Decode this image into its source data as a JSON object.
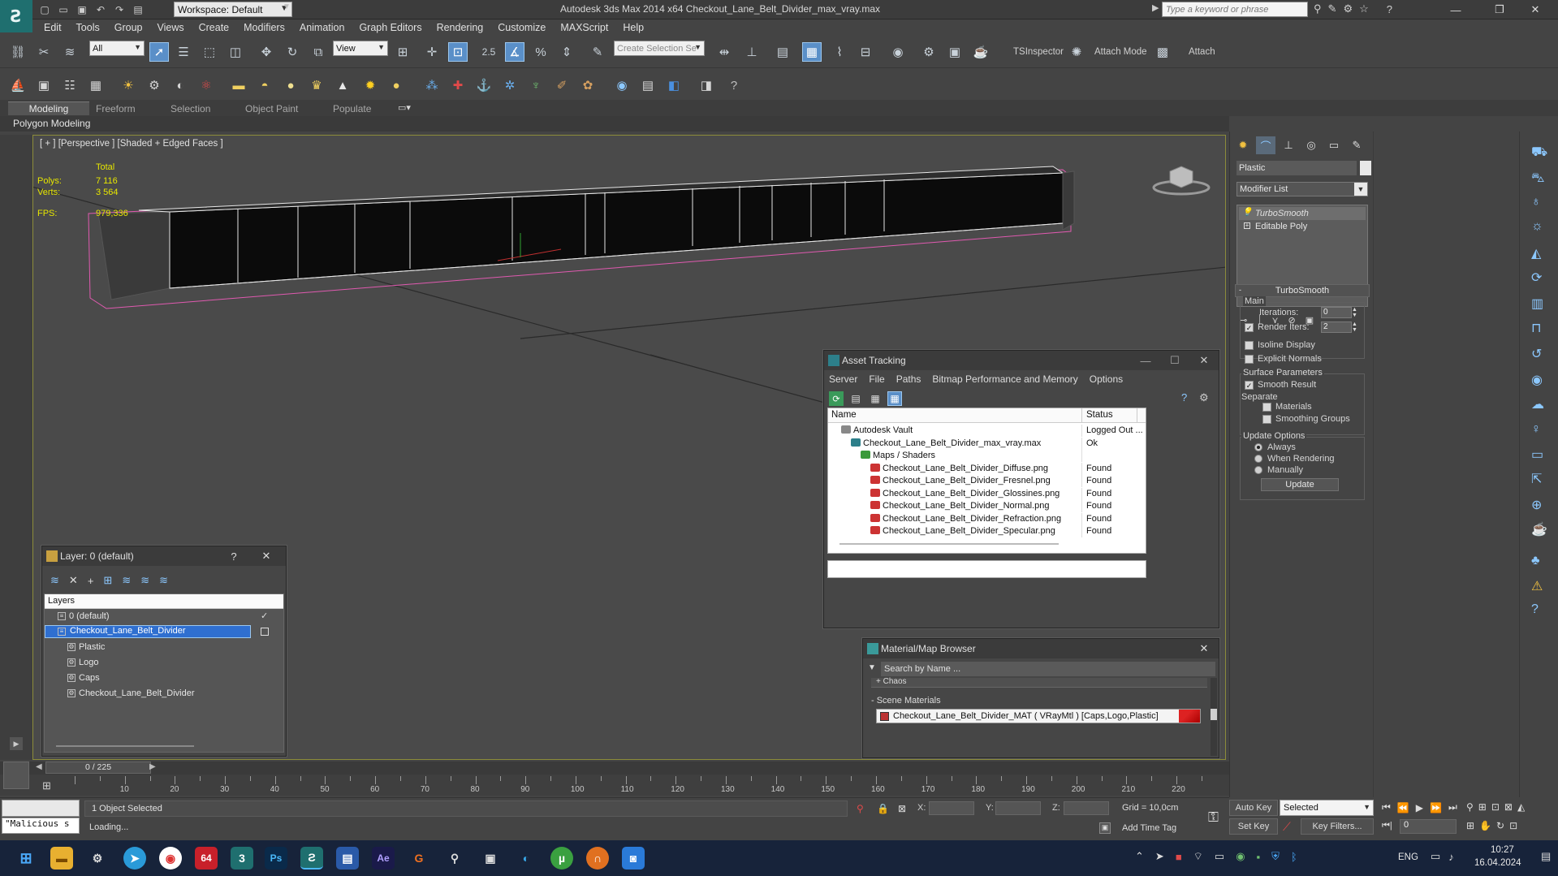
{
  "titlebar": {
    "workspace": "Workspace: Default",
    "app_title": "Autodesk 3ds Max  2014 x64     Checkout_Lane_Belt_Divider_max_vray.max",
    "search_placeholder": "Type a keyword or phrase"
  },
  "menu": [
    "Edit",
    "Tools",
    "Group",
    "Views",
    "Create",
    "Modifiers",
    "Animation",
    "Graph Editors",
    "Rendering",
    "Customize",
    "MAXScript",
    "Help"
  ],
  "toolbar": {
    "selection_filter": "All",
    "ref_coord": "View",
    "snap_value": "2.5",
    "named_selection": "Create Selection Se",
    "tsinspector": "TSInspector",
    "attach_mode": "Attach Mode",
    "attach": "Attach"
  },
  "ribbon": {
    "tabs": [
      "Modeling",
      "Freeform",
      "Selection",
      "Object Paint",
      "Populate"
    ],
    "sub": "Polygon Modeling"
  },
  "viewport": {
    "label": "[ + ] [Perspective ] [Shaded + Edged Faces ]",
    "stats": {
      "total_label": "Total",
      "polys_label": "Polys:",
      "polys": "7 116",
      "verts_label": "Verts:",
      "verts": "3 564",
      "fps_label": "FPS:",
      "fps": "979,336"
    }
  },
  "command_panel": {
    "object_name": "Plastic",
    "modifier_list": "Modifier List",
    "stack": [
      "TurboSmooth",
      "Editable Poly"
    ],
    "rollout": "TurboSmooth",
    "main_group": "Main",
    "iterations_label": "Iterations:",
    "iterations": "0",
    "render_iters_label": "Render Iters:",
    "render_iters": "2",
    "isoline": "Isoline Display",
    "explicit": "Explicit Normals",
    "surface_group": "Surface Parameters",
    "smooth_result": "Smooth Result",
    "separate": "Separate",
    "materials": "Materials",
    "smoothing_groups": "Smoothing Groups",
    "update_group": "Update Options",
    "always": "Always",
    "when_rendering": "When Rendering",
    "manually": "Manually",
    "update_button": "Update"
  },
  "asset_tracking": {
    "title": "Asset Tracking",
    "menu": [
      "Server",
      "File",
      "Paths",
      "Bitmap Performance and Memory",
      "Options"
    ],
    "col_name": "Name",
    "col_status": "Status",
    "rows": [
      {
        "name": "Autodesk Vault",
        "status": "Logged Out ...",
        "indent": 1
      },
      {
        "name": "Checkout_Lane_Belt_Divider_max_vray.max",
        "status": "Ok",
        "indent": 2
      },
      {
        "name": "Maps / Shaders",
        "status": "",
        "indent": 3
      },
      {
        "name": "Checkout_Lane_Belt_Divider_Diffuse.png",
        "status": "Found",
        "indent": 4
      },
      {
        "name": "Checkout_Lane_Belt_Divider_Fresnel.png",
        "status": "Found",
        "indent": 4
      },
      {
        "name": "Checkout_Lane_Belt_Divider_Glossines.png",
        "status": "Found",
        "indent": 4
      },
      {
        "name": "Checkout_Lane_Belt_Divider_Normal.png",
        "status": "Found",
        "indent": 4
      },
      {
        "name": "Checkout_Lane_Belt_Divider_Refraction.png",
        "status": "Found",
        "indent": 4
      },
      {
        "name": "Checkout_Lane_Belt_Divider_Specular.png",
        "status": "Found",
        "indent": 4
      }
    ]
  },
  "layer_window": {
    "title": "Layer: 0 (default)",
    "help": "?",
    "col_layers": "Layers",
    "items": [
      {
        "name": "0 (default)",
        "indent": 1,
        "checked": true
      },
      {
        "name": "Checkout_Lane_Belt_Divider",
        "indent": 1,
        "selected": true
      },
      {
        "name": "Plastic",
        "indent": 2
      },
      {
        "name": "Logo",
        "indent": 2
      },
      {
        "name": "Caps",
        "indent": 2
      },
      {
        "name": "Checkout_Lane_Belt_Divider",
        "indent": 2
      }
    ]
  },
  "material_browser": {
    "title": "Material/Map Browser",
    "search_placeholder": "Search by Name ...",
    "chaos": "+ Chaos",
    "scene_materials": "- Scene Materials",
    "material": "Checkout_Lane_Belt_Divider_MAT ( VRayMtl ) [Caps,Logo,Plastic]"
  },
  "timeline": {
    "frame": "0 / 225",
    "ticks": [
      "10",
      "20",
      "30",
      "40",
      "50",
      "60",
      "70",
      "80",
      "90",
      "100",
      "110",
      "120",
      "130",
      "140",
      "150",
      "160",
      "170",
      "180",
      "190",
      "200",
      "210",
      "220"
    ]
  },
  "status": {
    "selected": "1 Object Selected",
    "loading": "Loading...",
    "maxscript": "\"Malicious s",
    "x_label": "X:",
    "y_label": "Y:",
    "z_label": "Z:",
    "grid": "Grid = 10,0cm",
    "add_time_tag": "Add Time Tag",
    "auto_key": "Auto Key",
    "selected_set": "Selected",
    "set_key": "Set Key",
    "key_filters": "Key Filters...",
    "frame_field": "0"
  },
  "taskbar": {
    "lang": "ENG",
    "time": "10:27",
    "date": "16.04.2024",
    "badge": "64"
  }
}
